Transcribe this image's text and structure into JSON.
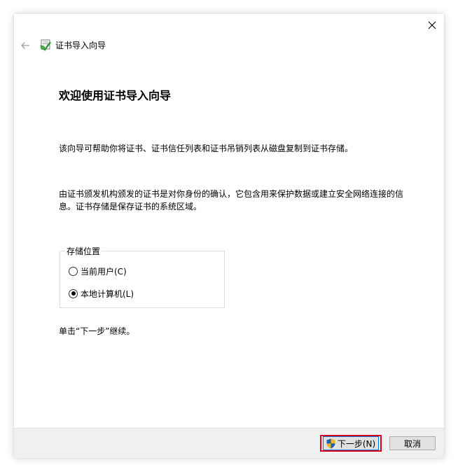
{
  "window": {
    "title": "证书导入向导",
    "close_icon": "close-icon",
    "back_icon": "back-arrow-icon",
    "app_icon": "certificate-icon"
  },
  "main": {
    "heading": "欢迎使用证书导入向导",
    "paragraph1": "该向导可帮助你将证书、证书信任列表和证书吊销列表从磁盘复制到证书存储。",
    "paragraph2_line1": "由证书颁发机构颁发的证书是对你身份的确认，它包含用来保护数据或建立安全网络连接的信",
    "paragraph2_line2": "息。证书存储是保存证书的系统区域。",
    "store_location": {
      "legend": "存储位置",
      "options": [
        {
          "label": "当前用户(C)",
          "selected": false
        },
        {
          "label": "本地计算机(L)",
          "selected": true
        }
      ]
    },
    "continue_hint": "单击“下一步”继续。"
  },
  "footer": {
    "next_label": "下一步(N)",
    "next_icon": "uac-shield-icon",
    "cancel_label": "取消",
    "highlight_color": "#d9001b"
  }
}
